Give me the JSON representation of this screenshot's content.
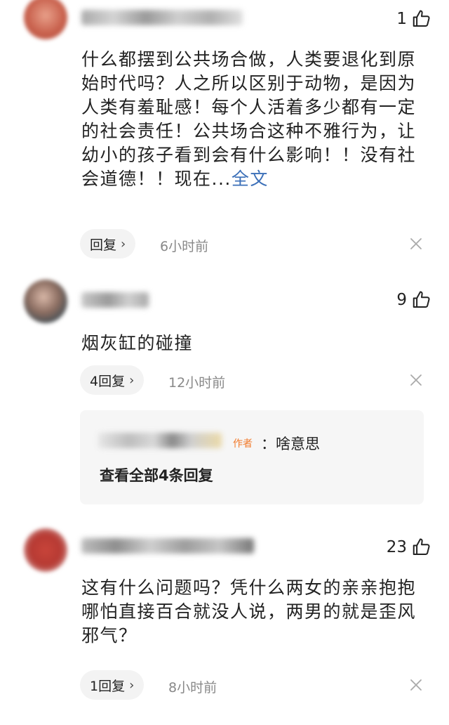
{
  "comments": [
    {
      "likes": "1",
      "text": "什么都摆到公共场合做，人类要退化到原始时代吗？人之所以区别于动物，是因为人类有羞耻感！每个人活着多少都有一定的社会责任！公共场合这种不雅行为，让幼小的孩子看到会有什么影响！！没有社会道德！！现在...",
      "full_text_link": "全文",
      "reply_label": "回复",
      "time": "6小时前"
    },
    {
      "likes": "9",
      "text": "烟灰缸的碰撞",
      "reply_label": "4回复",
      "time": "12小时前",
      "sub_reply": {
        "author_tag": "作者",
        "text": "：啥意思",
        "view_all": "查看全部4条回复"
      }
    },
    {
      "likes": "23",
      "text": "这有什么问题吗？凭什么两女的亲亲抱抱哪怕直接百合就没人说，两男的就是歪风邪气？",
      "reply_label": "1回复",
      "time": "8小时前"
    }
  ],
  "colors": {
    "link": "#3b6fb8",
    "author_tag": "#f27b2c",
    "muted": "#888888",
    "pill_bg": "#f3f3f3"
  },
  "icons": [
    "thumbs-up-icon",
    "close-icon",
    "chevron-right-icon"
  ]
}
